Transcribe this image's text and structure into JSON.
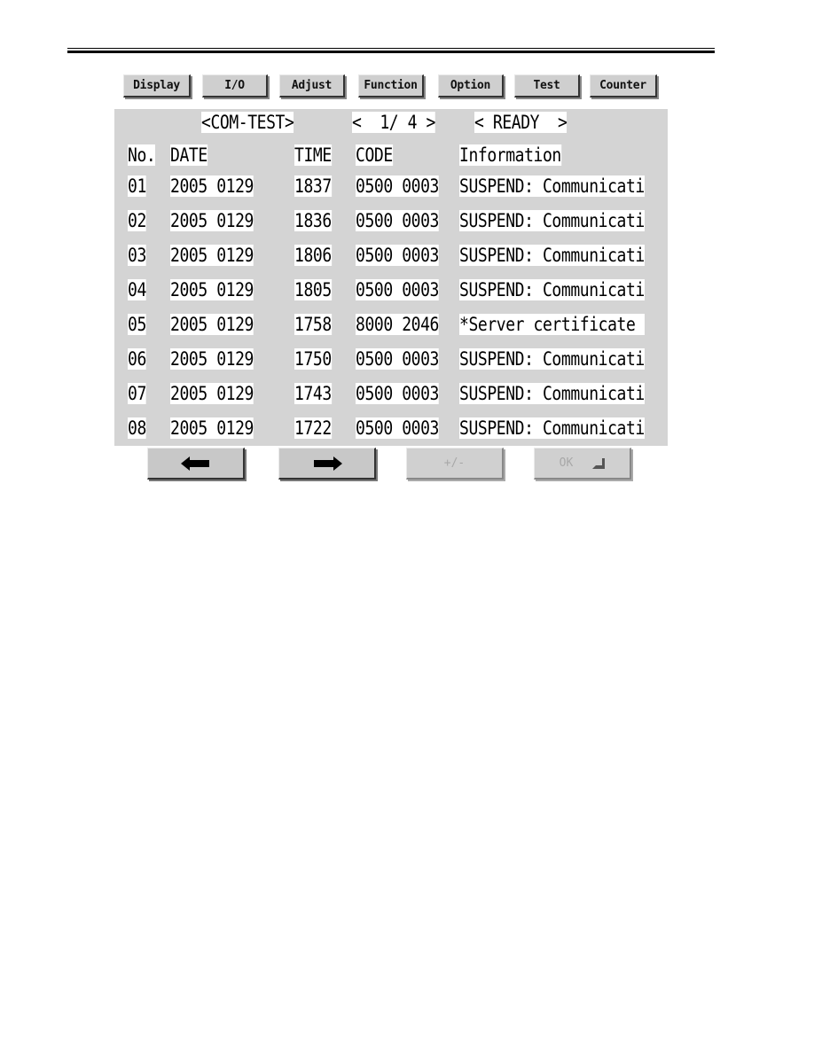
{
  "tabs": [
    {
      "label": "Display"
    },
    {
      "label": "I/O"
    },
    {
      "label": "Adjust"
    },
    {
      "label": "Function"
    },
    {
      "label": "Option"
    },
    {
      "label": "Test"
    },
    {
      "label": "Counter"
    }
  ],
  "header": {
    "mode": "<COM-TEST>",
    "page": "<  1/ 4 >",
    "status": "< READY  >"
  },
  "table": {
    "columns": [
      "No.",
      "DATE",
      "TIME",
      "CODE",
      "Information"
    ],
    "rows": [
      {
        "no": "01",
        "date": "2005 0129",
        "time": "1837",
        "code": "0500 0003",
        "info": "SUSPEND: Communicati"
      },
      {
        "no": "02",
        "date": "2005 0129",
        "time": "1836",
        "code": "0500 0003",
        "info": "SUSPEND: Communicati"
      },
      {
        "no": "03",
        "date": "2005 0129",
        "time": "1806",
        "code": "0500 0003",
        "info": "SUSPEND: Communicati"
      },
      {
        "no": "04",
        "date": "2005 0129",
        "time": "1805",
        "code": "0500 0003",
        "info": "SUSPEND: Communicati"
      },
      {
        "no": "05",
        "date": "2005 0129",
        "time": "1758",
        "code": "8000 2046",
        "info": "*Server certificate "
      },
      {
        "no": "06",
        "date": "2005 0129",
        "time": "1750",
        "code": "0500 0003",
        "info": "SUSPEND: Communicati"
      },
      {
        "no": "07",
        "date": "2005 0129",
        "time": "1743",
        "code": "0500 0003",
        "info": "SUSPEND: Communicati"
      },
      {
        "no": "08",
        "date": "2005 0129",
        "time": "1722",
        "code": "0500 0003",
        "info": "SUSPEND: Communicati"
      }
    ]
  },
  "footer": {
    "prev_icon": "left-arrow-icon",
    "next_icon": "right-arrow-icon",
    "plusminus_label": "+/-",
    "ok_label": "OK",
    "ok_icon": "enter-icon"
  }
}
